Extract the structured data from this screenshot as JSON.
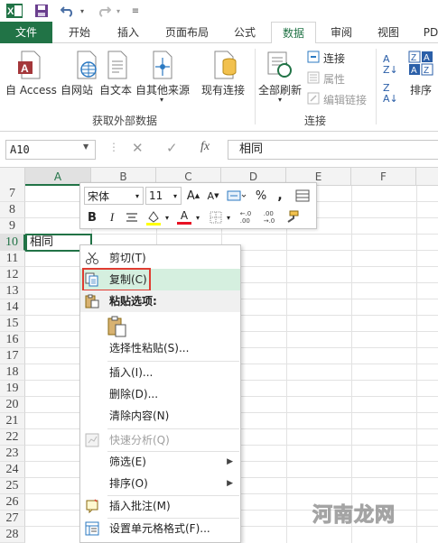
{
  "tabs": [
    "文件",
    "开始",
    "插入",
    "页面布局",
    "公式",
    "数据",
    "审阅",
    "视图",
    "PD"
  ],
  "ribbon": {
    "from_access": "自 Access",
    "from_web": "自网站",
    "from_text": "自文本",
    "from_other": "自其他来源",
    "existing_conn": "现有连接",
    "refresh_all": "全部刷新",
    "connections": "连接",
    "properties": "属性",
    "edit_links": "编辑链接",
    "sort": "排序",
    "group_external": "获取外部数据",
    "group_connections": "连接"
  },
  "formula_bar": {
    "name_box": "A10",
    "fx": "fx",
    "value": "相同"
  },
  "grid": {
    "columns": [
      "A",
      "B",
      "C",
      "D",
      "E",
      "F"
    ],
    "rows": [
      "7",
      "8",
      "9",
      "10",
      "11",
      "12",
      "13",
      "14",
      "15",
      "16",
      "17",
      "18",
      "19",
      "20",
      "21",
      "22",
      "23",
      "24",
      "25",
      "26",
      "27",
      "28"
    ],
    "selected_cell_text": "相同"
  },
  "mini_toolbar": {
    "font_name": "宋体",
    "font_size": "11",
    "percent": "%",
    "comma": ",",
    "bold": "B",
    "italic": "I",
    "font_color_letter": "A",
    "dec_inc": "←.0\n.00",
    "dec_dec": ".00\n→.0"
  },
  "context_menu": {
    "cut": "剪切(T)",
    "copy": "复制(C)",
    "paste_options": "粘贴选项:",
    "paste_special": "选择性粘贴(S)...",
    "insert": "插入(I)...",
    "delete": "删除(D)...",
    "clear": "清除内容(N)",
    "quick_analysis": "快速分析(Q)",
    "filter": "筛选(E)",
    "sort": "排序(O)",
    "insert_comment": "插入批注(M)",
    "format_cells": "设置单元格格式(F)..."
  },
  "watermark": "河南龙网",
  "colors": {
    "excel_green": "#217346",
    "highlight": "#d5efdf",
    "red_box": "#e03c31"
  }
}
